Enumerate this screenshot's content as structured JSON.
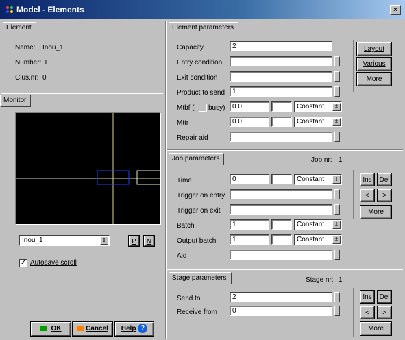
{
  "window": {
    "title": "Model - Elements",
    "close": "×"
  },
  "element": {
    "tab": "Element",
    "name_label": "Name:",
    "name_value": "Inou_1",
    "number_label": "Number:",
    "number_value": "1",
    "clusnr_label": "Clus.nr:",
    "clusnr_value": "0"
  },
  "monitor": {
    "tab": "Monitor",
    "select_value": "Inou_1",
    "p_button": "P",
    "n_button": "N",
    "autosave_checked": true,
    "autosave_label": "Autosave scroll"
  },
  "footer": {
    "ok": "OK",
    "cancel": "Cancel",
    "help": "Help"
  },
  "element_params": {
    "tab": "Element parameters",
    "capacity_label": "Capacity",
    "capacity_value": "2",
    "entry_label": "Entry condition",
    "entry_value": "",
    "exit_label": "Exit condition",
    "exit_value": "",
    "product_label": "Product to send",
    "product_value": "1",
    "mtbf_label": "Mtbf (",
    "busy_label": "busy)",
    "mtbf_value": "0.0",
    "mtbf_dist": "Constant",
    "mttr_label": "Mttr",
    "mttr_value": "0.0",
    "mttr_dist": "Constant",
    "repair_label": "Repair aid",
    "repair_value": "",
    "buttons": {
      "layout": "Layout",
      "various": "Various",
      "more": "More"
    }
  },
  "job_params": {
    "tab": "Job parameters",
    "jobnr_label": "Job nr:",
    "jobnr_value": "1",
    "time_label": "Time",
    "time_value": "0",
    "time_dist": "Constant",
    "trig_entry_label": "Trigger on entry",
    "trig_entry_value": "",
    "trig_exit_label": "Trigger on exit",
    "trig_exit_value": "",
    "batch_label": "Batch",
    "batch_value": "1",
    "batch_dist": "Constant",
    "outbatch_label": "Output batch",
    "outbatch_value": "1",
    "outbatch_dist": "Constant",
    "aid_label": "Aid",
    "aid_value": "",
    "buttons": {
      "ins": "Ins",
      "del": "Del",
      "prev": "<",
      "next": ">",
      "more": "More"
    }
  },
  "stage_params": {
    "tab": "Stage parameters",
    "stagenr_label": "Stage nr:",
    "stagenr_value": "1",
    "sendto_label": "Send to",
    "sendto_value": "2",
    "receive_label": "Receive from",
    "receive_value": "0",
    "buttons": {
      "ins": "Ins",
      "del": "Del",
      "prev": "<",
      "next": ">",
      "more": "More"
    }
  }
}
